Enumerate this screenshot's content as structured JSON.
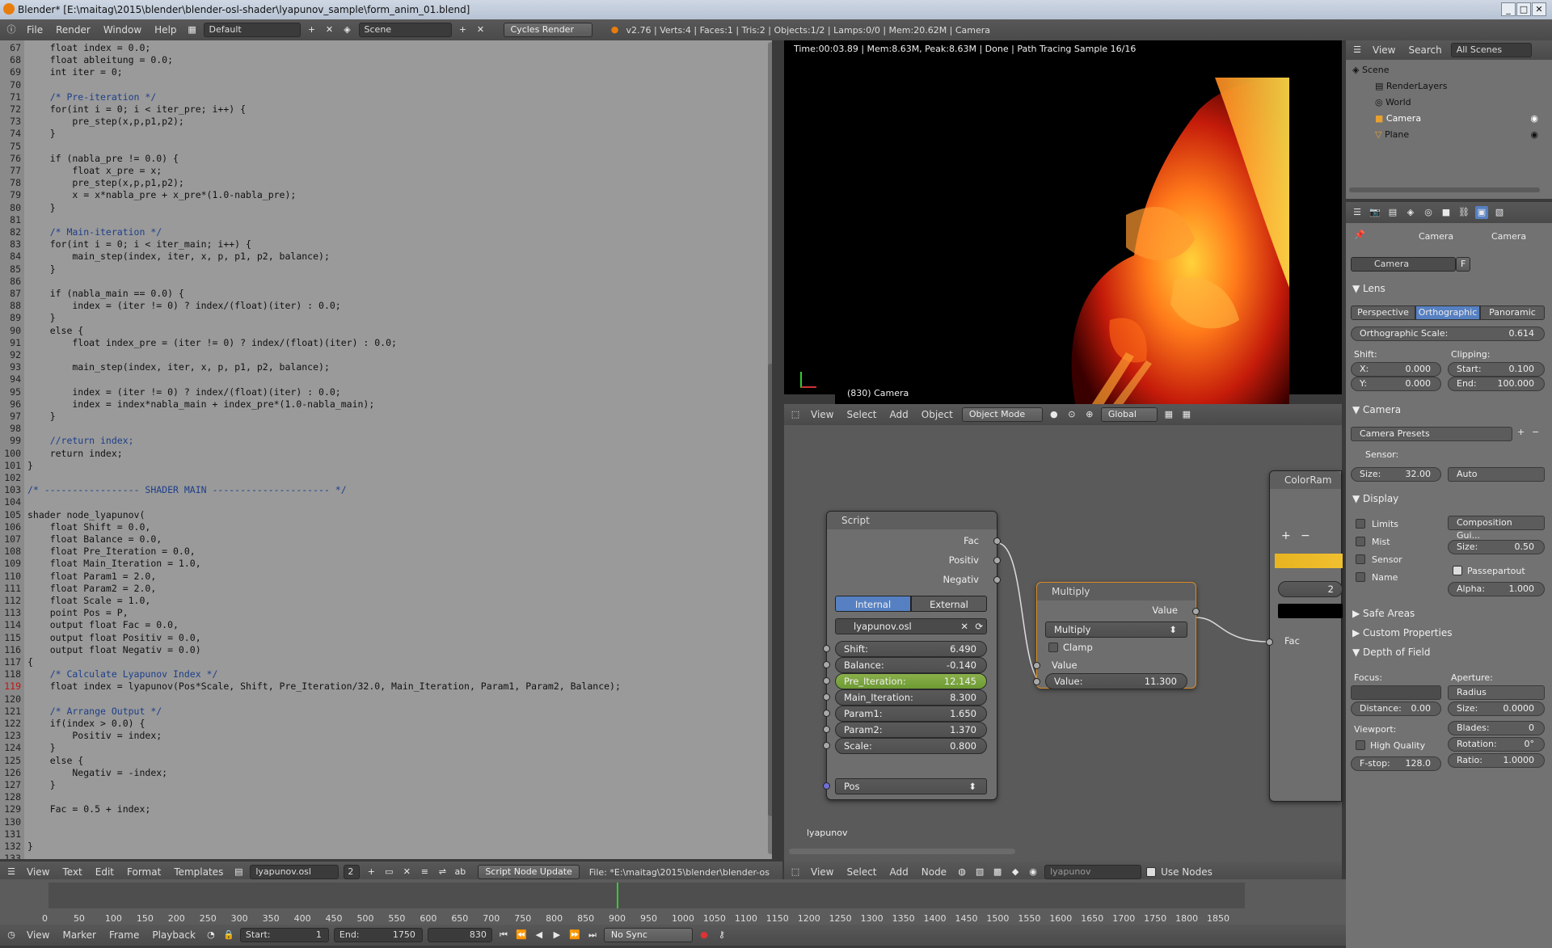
{
  "window": {
    "title": "Blender* [E:\\maitag\\2015\\blender\\blender-osl-shader\\lyapunov_sample\\form_anim_01.blend]"
  },
  "info": {
    "menus": [
      "File",
      "Render",
      "Window",
      "Help"
    ],
    "layout": "Default",
    "scene": "Scene",
    "engine": "Cycles Render",
    "stats": "v2.76 | Verts:4 | Faces:1 | Tris:2 | Objects:1/2 | Lamps:0/0 | Mem:20.62M | Camera"
  },
  "text_editor": {
    "lines": [
      [
        "67",
        "    float index = 0.0;"
      ],
      [
        "68",
        "    float ableitung = 0.0;"
      ],
      [
        "69",
        "    int iter = 0;"
      ],
      [
        "70",
        ""
      ],
      [
        "71",
        "    /* Pre-iteration */"
      ],
      [
        "72",
        "    for(int i = 0; i < iter_pre; i++) {"
      ],
      [
        "73",
        "        pre_step(x,p,p1,p2);"
      ],
      [
        "74",
        "    }"
      ],
      [
        "75",
        ""
      ],
      [
        "76",
        "    if (nabla_pre != 0.0) {"
      ],
      [
        "77",
        "        float x_pre = x;"
      ],
      [
        "78",
        "        pre_step(x,p,p1,p2);"
      ],
      [
        "79",
        "        x = x*nabla_pre + x_pre*(1.0-nabla_pre);"
      ],
      [
        "80",
        "    }"
      ],
      [
        "81",
        ""
      ],
      [
        "82",
        "    /* Main-iteration */"
      ],
      [
        "83",
        "    for(int i = 0; i < iter_main; i++) {"
      ],
      [
        "84",
        "        main_step(index, iter, x, p, p1, p2, balance);"
      ],
      [
        "85",
        "    }"
      ],
      [
        "86",
        ""
      ],
      [
        "87",
        "    if (nabla_main == 0.0) {"
      ],
      [
        "88",
        "        index = (iter != 0) ? index/(float)(iter) : 0.0;"
      ],
      [
        "89",
        "    }"
      ],
      [
        "90",
        "    else {"
      ],
      [
        "91",
        "        float index_pre = (iter != 0) ? index/(float)(iter) : 0.0;"
      ],
      [
        "92",
        ""
      ],
      [
        "93",
        "        main_step(index, iter, x, p, p1, p2, balance);"
      ],
      [
        "94",
        ""
      ],
      [
        "95",
        "        index = (iter != 0) ? index/(float)(iter) : 0.0;"
      ],
      [
        "96",
        "        index = index*nabla_main + index_pre*(1.0-nabla_main);"
      ],
      [
        "97",
        "    }"
      ],
      [
        "98",
        ""
      ],
      [
        "99",
        "    //return index;"
      ],
      [
        "100",
        "    return index;"
      ],
      [
        "101",
        "}"
      ],
      [
        "102",
        ""
      ],
      [
        "103",
        "/* ----------------- SHADER MAIN --------------------- */"
      ],
      [
        "104",
        ""
      ],
      [
        "105",
        "shader node_lyapunov("
      ],
      [
        "106",
        "    float Shift = 0.0,"
      ],
      [
        "107",
        "    float Balance = 0.0,"
      ],
      [
        "108",
        "    float Pre_Iteration = 0.0,"
      ],
      [
        "109",
        "    float Main_Iteration = 1.0,"
      ],
      [
        "110",
        "    float Param1 = 2.0,"
      ],
      [
        "111",
        "    float Param2 = 2.0,"
      ],
      [
        "112",
        "    float Scale = 1.0,"
      ],
      [
        "113",
        "    point Pos = P,"
      ],
      [
        "114",
        "    output float Fac = 0.0,"
      ],
      [
        "115",
        "    output float Positiv = 0.0,"
      ],
      [
        "116",
        "    output float Negativ = 0.0)"
      ],
      [
        "117",
        "{"
      ],
      [
        "118",
        "    /* Calculate Lyapunov Index */"
      ],
      [
        "119",
        "    float index = lyapunov(Pos*Scale, Shift, Pre_Iteration/32.0, Main_Iteration, Param1, Param2, Balance);"
      ],
      [
        "120",
        ""
      ],
      [
        "121",
        "    /* Arrange Output */"
      ],
      [
        "122",
        "    if(index > 0.0) {"
      ],
      [
        "123",
        "        Positiv = index;"
      ],
      [
        "124",
        "    }"
      ],
      [
        "125",
        "    else {"
      ],
      [
        "126",
        "        Negativ = -index;"
      ],
      [
        "127",
        "    }"
      ],
      [
        "128",
        ""
      ],
      [
        "129",
        "    Fac = 0.5 + index;"
      ],
      [
        "130",
        ""
      ],
      [
        "131",
        ""
      ],
      [
        "132",
        "}"
      ],
      [
        "133",
        ""
      ]
    ],
    "current_line": "119",
    "header": {
      "menus": [
        "View",
        "Text",
        "Edit",
        "Format",
        "Templates"
      ],
      "file": "lyapunov.osl",
      "users": "2",
      "update_btn": "Script Node Update",
      "path": "File: *E:\\maitag\\2015\\blender\\blender-os"
    }
  },
  "viewport": {
    "render_info": "Time:00:03.89 | Mem:8.63M, Peak:8.63M | Done | Path Tracing Sample 16/16",
    "object_label": "(830) Camera",
    "menus": [
      "View",
      "Select",
      "Add",
      "Object"
    ],
    "mode": "Object Mode",
    "orientation": "Global"
  },
  "node_editor": {
    "script_node": {
      "title": "Script",
      "outputs": [
        "Fac",
        "Positiv",
        "Negativ"
      ],
      "tab_internal": "Internal",
      "tab_external": "External",
      "script": "lyapunov.osl",
      "inputs": [
        [
          "Shift:",
          "6.490"
        ],
        [
          "Balance:",
          "-0.140"
        ],
        [
          "Pre_Iteration:",
          "12.145"
        ],
        [
          "Main_Iteration:",
          "8.300"
        ],
        [
          "Param1:",
          "1.650"
        ],
        [
          "Param2:",
          "1.370"
        ],
        [
          "Scale:",
          "0.800"
        ]
      ],
      "pos": "Pos"
    },
    "multiply_node": {
      "title": "Multiply",
      "output": "Value",
      "op": "Multiply",
      "clamp": "Clamp",
      "in_label": "Value",
      "value_label": "Value:",
      "value": "11.300"
    },
    "colorramp_node": {
      "title": "ColorRam",
      "stop": "2",
      "fac": "Fac"
    },
    "tree_name": "lyapunov",
    "menus": [
      "View",
      "Select",
      "Add",
      "Node"
    ],
    "material": "lyapunov",
    "use_nodes": "Use Nodes"
  },
  "outliner": {
    "menus": [
      "View",
      "Search"
    ],
    "filter": "All Scenes",
    "items": [
      "Scene",
      "RenderLayers",
      "World",
      "Camera",
      "Plane"
    ]
  },
  "properties": {
    "breadcrumb": [
      "Camera",
      "Camera"
    ],
    "datablock": "Camera",
    "fake": "F",
    "lens": {
      "title": "Lens",
      "types": [
        "Perspective",
        "Orthographic",
        "Panoramic"
      ],
      "ortho_label": "Orthographic Scale:",
      "ortho": "0.614",
      "shift": "Shift:",
      "shift_x": [
        "X:",
        "0.000"
      ],
      "shift_y": [
        "Y:",
        "0.000"
      ],
      "clipping": "Clipping:",
      "clip_start": [
        "Start:",
        "0.100"
      ],
      "clip_end": [
        "End:",
        "100.000"
      ]
    },
    "camera": {
      "title": "Camera",
      "presets": "Camera Presets",
      "sensor": "Sensor:",
      "size": [
        "Size:",
        "32.00"
      ],
      "fit": "Auto"
    },
    "display": {
      "title": "Display",
      "checks": [
        "Limits",
        "Mist",
        "Sensor",
        "Name"
      ],
      "composition": "Composition Gui...",
      "size": [
        "Size:",
        "0.50"
      ],
      "passepartout": "Passepartout",
      "alpha": [
        "Alpha:",
        "1.000"
      ]
    },
    "safe_areas": "Safe Areas",
    "custom_props": "Custom Properties",
    "dof": {
      "title": "Depth of Field",
      "focus": "Focus:",
      "distance": [
        "Distance:",
        "0.00"
      ],
      "aperture": "Aperture:",
      "aperture_type": "Radius",
      "ap_size": [
        "Size:",
        "0.0000"
      ],
      "blades": [
        "Blades:",
        "0"
      ],
      "rotation": [
        "Rotation:",
        "0°"
      ],
      "ratio": [
        "Ratio:",
        "1.0000"
      ],
      "viewport": "Viewport:",
      "hq": "High Quality",
      "fstop": [
        "F-stop:",
        "128.0"
      ]
    }
  },
  "timeline": {
    "ticks": [
      "0",
      "50",
      "100",
      "150",
      "200",
      "250",
      "300",
      "350",
      "400",
      "450",
      "500",
      "550",
      "600",
      "650",
      "700",
      "750",
      "800",
      "850",
      "900",
      "950",
      "1000",
      "1050",
      "1100",
      "1150",
      "1200",
      "1250",
      "1300",
      "1350",
      "1400",
      "1450",
      "1500",
      "1550",
      "1600",
      "1650",
      "1700",
      "1750",
      "1800",
      "1850"
    ],
    "menus": [
      "View",
      "Marker",
      "Frame",
      "Playback"
    ],
    "start": [
      "Start:",
      "1"
    ],
    "end": [
      "End:",
      "1750"
    ],
    "current": "830",
    "sync": "No Sync"
  }
}
